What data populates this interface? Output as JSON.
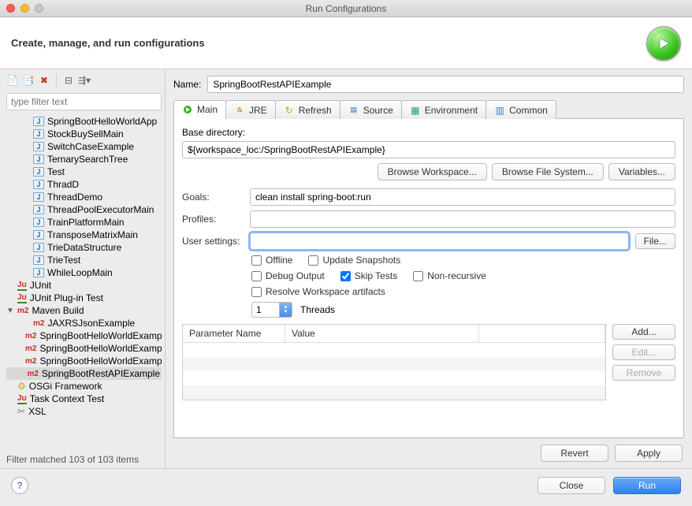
{
  "window": {
    "title": "Run Configurations"
  },
  "header": {
    "title": "Create, manage, and run configurations"
  },
  "sidebar": {
    "filter_placeholder": "type filter text",
    "items": [
      {
        "label": "SpringBootHelloWorldApp",
        "icon": "j",
        "indent": 1
      },
      {
        "label": "StockBuySellMain",
        "icon": "j",
        "indent": 1
      },
      {
        "label": "SwitchCaseExample",
        "icon": "j",
        "indent": 1
      },
      {
        "label": "TernarySearchTree",
        "icon": "j",
        "indent": 1
      },
      {
        "label": "Test",
        "icon": "j",
        "indent": 1
      },
      {
        "label": "ThradD",
        "icon": "j",
        "indent": 1
      },
      {
        "label": "ThreadDemo",
        "icon": "j",
        "indent": 1
      },
      {
        "label": "ThreadPoolExecutorMain",
        "icon": "j",
        "indent": 1
      },
      {
        "label": "TrainPlatformMain",
        "icon": "j",
        "indent": 1
      },
      {
        "label": "TransposeMatrixMain",
        "icon": "j",
        "indent": 1
      },
      {
        "label": "TrieDataStructure",
        "icon": "j",
        "indent": 1
      },
      {
        "label": "TrieTest",
        "icon": "j",
        "indent": 1
      },
      {
        "label": "WhileLoopMain",
        "icon": "j",
        "indent": 1
      },
      {
        "label": "JUnit",
        "icon": "ju",
        "indent": 0
      },
      {
        "label": "JUnit Plug-in Test",
        "icon": "ju",
        "indent": 0
      },
      {
        "label": "Maven Build",
        "icon": "m2",
        "indent": 0,
        "expanded": true
      },
      {
        "label": "JAXRSJsonExample",
        "icon": "m2",
        "indent": 1
      },
      {
        "label": "SpringBootHelloWorldExample",
        "icon": "m2",
        "indent": 1
      },
      {
        "label": "SpringBootHelloWorldExample",
        "icon": "m2",
        "indent": 1
      },
      {
        "label": "SpringBootHelloWorldExample",
        "icon": "m2",
        "indent": 1
      },
      {
        "label": "SpringBootRestAPIExample",
        "icon": "m2",
        "indent": 1,
        "selected": true
      },
      {
        "label": "OSGi Framework",
        "icon": "osgi",
        "indent": 0
      },
      {
        "label": "Task Context Test",
        "icon": "ju",
        "indent": 0
      },
      {
        "label": "XSL",
        "icon": "xsl",
        "indent": 0
      }
    ],
    "status": "Filter matched 103 of 103 items"
  },
  "form": {
    "name_label": "Name:",
    "name_value": "SpringBootRestAPIExample",
    "tabs": [
      {
        "label": "Main",
        "active": true,
        "icon": "run"
      },
      {
        "label": "JRE",
        "icon": "jre"
      },
      {
        "label": "Refresh",
        "icon": "refresh"
      },
      {
        "label": "Source",
        "icon": "source"
      },
      {
        "label": "Environment",
        "icon": "env"
      },
      {
        "label": "Common",
        "icon": "common"
      }
    ],
    "base_dir_label": "Base directory:",
    "base_dir_value": "${workspace_loc:/SpringBootRestAPIExample}",
    "browse_workspace": "Browse Workspace...",
    "browse_filesystem": "Browse File System...",
    "variables": "Variables...",
    "goals_label": "Goals:",
    "goals_value": "clean install spring-boot:run",
    "profiles_label": "Profiles:",
    "profiles_value": "",
    "user_settings_label": "User settings:",
    "user_settings_value": "",
    "file_btn": "File...",
    "checks": {
      "offline": "Offline",
      "update_snapshots": "Update Snapshots",
      "debug_output": "Debug Output",
      "skip_tests": "Skip Tests",
      "non_recursive": "Non-recursive",
      "resolve_workspace": "Resolve Workspace artifacts"
    },
    "threads_value": "1",
    "threads_label": "Threads",
    "param_table": {
      "col_name": "Parameter Name",
      "col_value": "Value"
    },
    "add_btn": "Add...",
    "edit_btn": "Edit...",
    "remove_btn": "Remove",
    "revert_btn": "Revert",
    "apply_btn": "Apply"
  },
  "bottom": {
    "close": "Close",
    "run": "Run"
  }
}
